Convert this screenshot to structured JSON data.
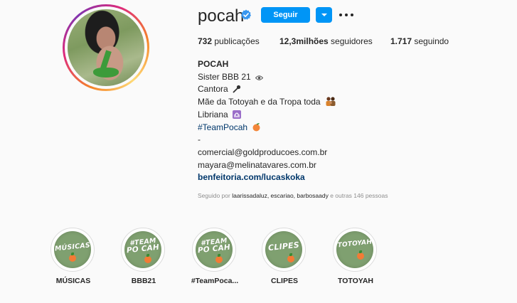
{
  "profile": {
    "username": "pocah",
    "follow_label": "Seguir",
    "stats": {
      "posts_count": "732",
      "posts_label": "publicações",
      "followers_count": "12,3milhões",
      "followers_label": "seguidores",
      "following_count": "1.717",
      "following_label": "seguindo"
    },
    "bio": {
      "name": "POCAH",
      "line1": "Sister BBB 21",
      "line2": "Cantora",
      "line3": "Mãe da Totoyah e da Tropa toda",
      "line4": "Libriana",
      "hashtag": "#TeamPocah",
      "dash": "-",
      "email1": "comercial@goldproducoes.com.br",
      "email2": "mayara@melinatavares.com.br",
      "link": "benfeitoria.com/lucaskoka"
    },
    "followed_by": {
      "prefix": "Seguido por",
      "users": "laarissadaluz, escariao, barbosaady",
      "suffix": "e outras 146 pessoas"
    }
  },
  "highlights": [
    {
      "label": "MÚSICAS",
      "cover_text_1": "MÚSICAS",
      "cover_text_2": ""
    },
    {
      "label": "BBB21",
      "cover_text_1": "#TEAM",
      "cover_text_2": "PO CAH"
    },
    {
      "label": "#TeamPoca...",
      "cover_text_1": "#TEAM",
      "cover_text_2": "PO CAH"
    },
    {
      "label": "CLIPES",
      "cover_text_1": "CLIPES",
      "cover_text_2": ""
    },
    {
      "label": "TOTOYAH",
      "cover_text_1": "TOTOYAH",
      "cover_text_2": ""
    }
  ],
  "colors": {
    "accent": "#0095f6",
    "link": "#00376b",
    "muted": "#8e8e8e",
    "highlight_bg": "#7fa070"
  },
  "icons": [
    "verified-badge-icon",
    "eye-icon",
    "microphone-icon",
    "family-icon",
    "libra-icon",
    "peach-icon",
    "more-options-icon",
    "chevron-down-icon"
  ]
}
